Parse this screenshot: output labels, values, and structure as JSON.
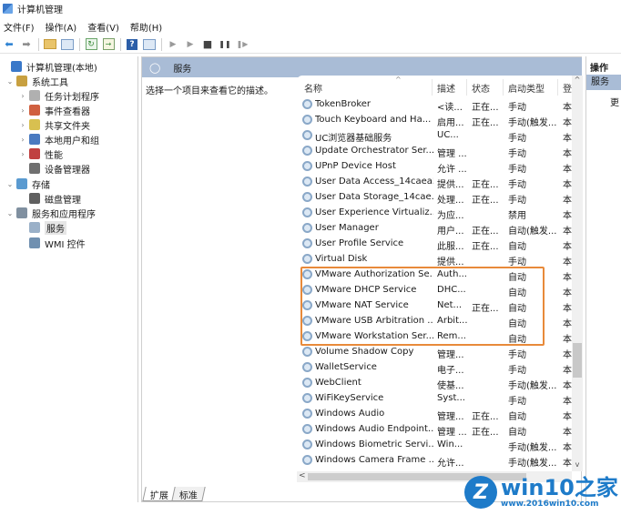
{
  "window": {
    "title": "计算机管理"
  },
  "menu": [
    "文件(F)",
    "操作(A)",
    "查看(V)",
    "帮助(H)"
  ],
  "toolbar": {
    "back": "back-arrow",
    "forward": "forward-arrow",
    "play": "▶",
    "play2": "▶",
    "stop": "■",
    "pause": "❚❚",
    "resume": "❚▶",
    "help": "?"
  },
  "tree": [
    {
      "label": "计算机管理(本地)",
      "level": 0,
      "twisty": "",
      "icon": "computer-icon",
      "color": "#3a78c9"
    },
    {
      "label": "系统工具",
      "level": 1,
      "twisty": "⌄",
      "icon": "tools-icon",
      "color": "#c8a040"
    },
    {
      "label": "任务计划程序",
      "level": 2,
      "twisty": "›",
      "icon": "clock-icon",
      "color": "#b0b0b0"
    },
    {
      "label": "事件查看器",
      "level": 2,
      "twisty": "›",
      "icon": "event-viewer-icon",
      "color": "#d06040"
    },
    {
      "label": "共享文件夹",
      "level": 2,
      "twisty": "›",
      "icon": "shared-folder-icon",
      "color": "#d8c050"
    },
    {
      "label": "本地用户和组",
      "level": 2,
      "twisty": "›",
      "icon": "users-icon",
      "color": "#4a7ac0"
    },
    {
      "label": "性能",
      "level": 2,
      "twisty": "›",
      "icon": "performance-icon",
      "color": "#c04040"
    },
    {
      "label": "设备管理器",
      "level": 2,
      "twisty": "",
      "icon": "device-manager-icon",
      "color": "#707070"
    },
    {
      "label": "存储",
      "level": 1,
      "twisty": "⌄",
      "icon": "storage-icon",
      "color": "#5a9ad0"
    },
    {
      "label": "磁盘管理",
      "level": 2,
      "twisty": "",
      "icon": "disk-icon",
      "color": "#606060"
    },
    {
      "label": "服务和应用程序",
      "level": 1,
      "twisty": "⌄",
      "icon": "services-apps-icon",
      "color": "#8090a0"
    },
    {
      "label": "服务",
      "level": 2,
      "twisty": "",
      "icon": "services-icon",
      "color": "#9ab0c8",
      "selected": true
    },
    {
      "label": "WMI 控件",
      "level": 2,
      "twisty": "",
      "icon": "wmi-icon",
      "color": "#7090b0"
    }
  ],
  "center": {
    "header": "服务",
    "description": "选择一个项目来查看它的描述。",
    "columns": [
      "名称",
      "描述",
      "状态",
      "启动类型",
      "登"
    ],
    "rows": [
      [
        "TokenBroker",
        "<读...",
        "正在...",
        "手动",
        "本"
      ],
      [
        "Touch Keyboard and Ha...",
        "启用...",
        "正在...",
        "手动(触发...",
        "本"
      ],
      [
        "UC浏览器基础服务",
        "UC...",
        "",
        "手动",
        "本"
      ],
      [
        "Update Orchestrator Ser...",
        "管理 ...",
        "",
        "手动",
        "本"
      ],
      [
        "UPnP Device Host",
        "允许 ...",
        "",
        "手动",
        "本"
      ],
      [
        "User Data Access_14caea5",
        "提供...",
        "正在...",
        "手动",
        "本"
      ],
      [
        "User Data Storage_14cae...",
        "处理...",
        "正在...",
        "手动",
        "本"
      ],
      [
        "User Experience Virtualiz...",
        "为应...",
        "",
        "禁用",
        "本"
      ],
      [
        "User Manager",
        "用户...",
        "正在...",
        "自动(触发...",
        "本"
      ],
      [
        "User Profile Service",
        "此服...",
        "正在...",
        "自动",
        "本"
      ],
      [
        "Virtual Disk",
        "提供...",
        "",
        "手动",
        "本"
      ],
      [
        "VMware Authorization Se...",
        "Auth...",
        "",
        "自动",
        "本"
      ],
      [
        "VMware DHCP Service",
        "DHC...",
        "",
        "自动",
        "本"
      ],
      [
        "VMware NAT Service",
        "Net...",
        "正在...",
        "自动",
        "本"
      ],
      [
        "VMware USB Arbitration ...",
        "Arbit...",
        "",
        "自动",
        "本"
      ],
      [
        "VMware Workstation Ser...",
        "Rem...",
        "",
        "自动",
        "本"
      ],
      [
        "Volume Shadow Copy",
        "管理...",
        "",
        "手动",
        "本"
      ],
      [
        "WalletService",
        "电子...",
        "",
        "手动",
        "本"
      ],
      [
        "WebClient",
        "使基...",
        "",
        "手动(触发...",
        "本"
      ],
      [
        "WiFiKeyService",
        "Syst...",
        "",
        "手动",
        "本"
      ],
      [
        "Windows Audio",
        "管理...",
        "正在...",
        "自动",
        "本"
      ],
      [
        "Windows Audio Endpoint...",
        "管理 ...",
        "正在...",
        "自动",
        "本"
      ],
      [
        "Windows Biometric Servi...",
        "Win...",
        "",
        "手动(触发...",
        "本"
      ],
      [
        "Windows Camera Frame ...",
        "允许...",
        "",
        "手动(触发...",
        "本"
      ]
    ],
    "tabs": [
      "扩展",
      "标准"
    ]
  },
  "actions": {
    "title": "操作",
    "section": "服务",
    "more": "更"
  },
  "watermark": {
    "brand": "win10之家",
    "url": "www.2016win10.com"
  },
  "colors": {
    "highlight": "#e88a3a",
    "header": "#a9bcd6",
    "brand": "#1e7bc9"
  }
}
